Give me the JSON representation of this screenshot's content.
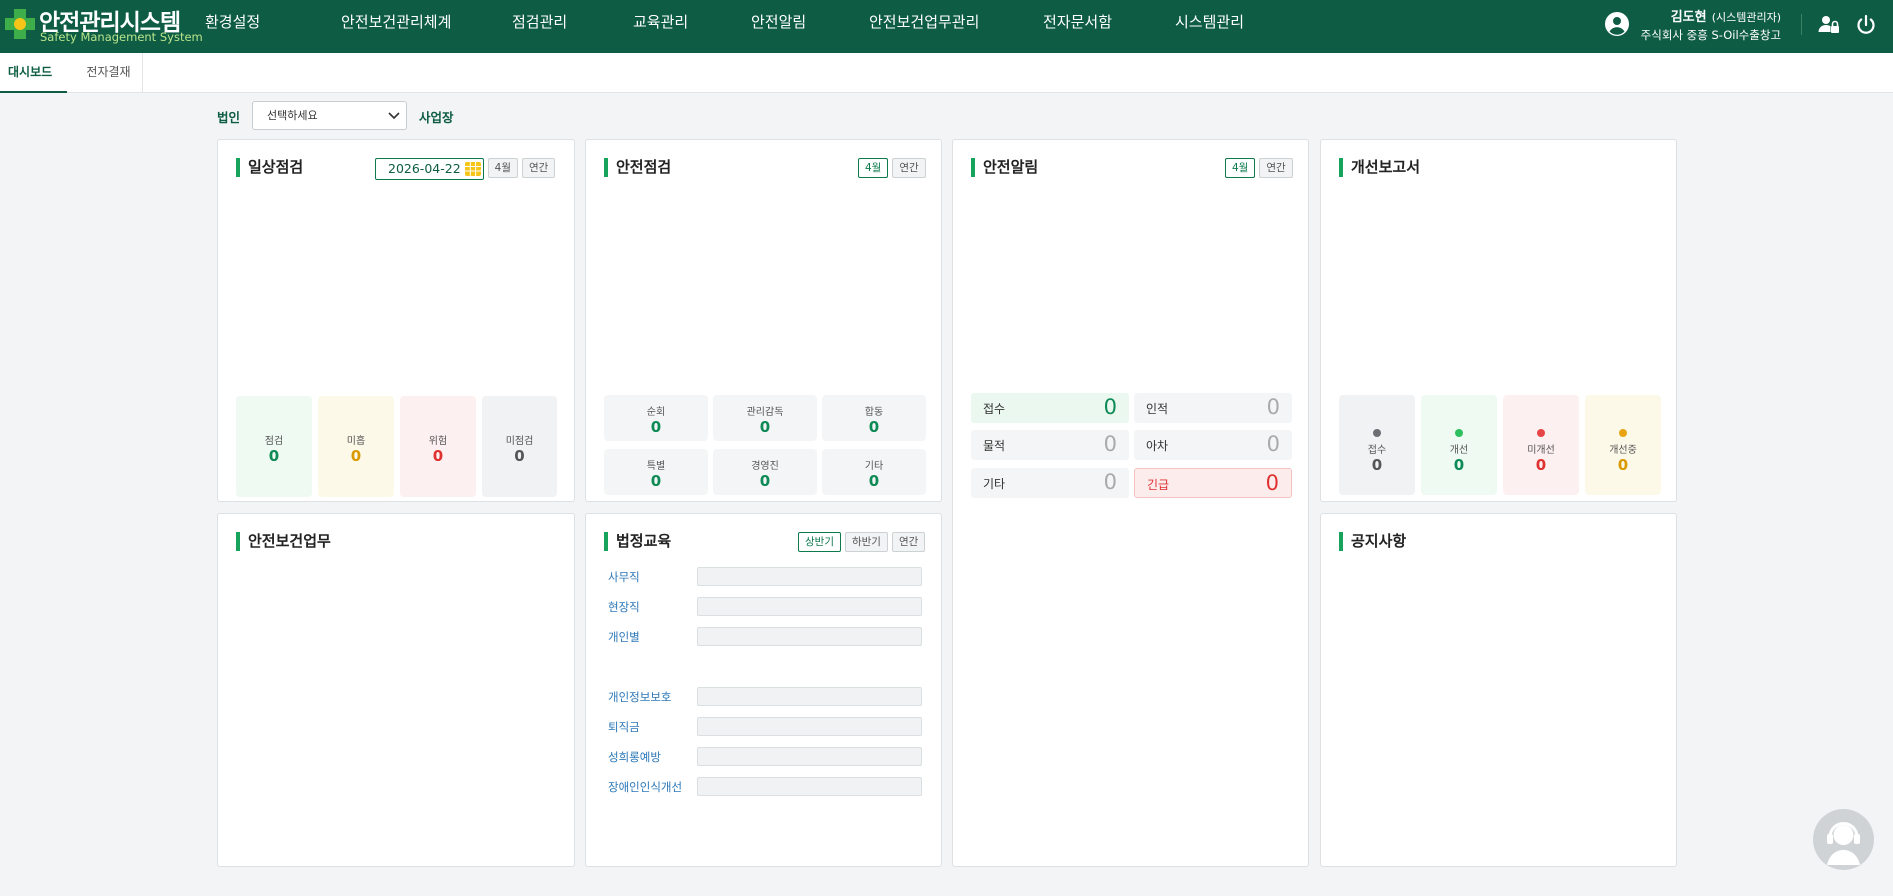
{
  "header": {
    "logo_title": "안전관리시스템",
    "logo_subtitle": "Safety Management System",
    "nav": [
      "환경설정",
      "안전보건관리체계",
      "점검관리",
      "교육관리",
      "안전알림",
      "안전보건업무관리",
      "전자문서함",
      "시스템관리"
    ],
    "user_name": "김도현",
    "user_role": "(시스템관리자)",
    "user_company": "주식회사 중흥 S-Oil수출창고",
    "icons": [
      "user-circle-icon",
      "user-lock-icon",
      "power-icon"
    ]
  },
  "tabs": [
    "대시보드",
    "전자결재"
  ],
  "filters": {
    "corp_label": "법인",
    "corp_placeholder": "선택하세요",
    "site_label": "사업장"
  },
  "daily": {
    "title": "일상점검",
    "date": "2026-04-22",
    "month_label": "4월",
    "year_label": "연간",
    "stats": [
      {
        "label": "점검",
        "value": "0"
      },
      {
        "label": "미흡",
        "value": "0"
      },
      {
        "label": "위험",
        "value": "0"
      },
      {
        "label": "미점검",
        "value": "0"
      }
    ]
  },
  "safety_check": {
    "title": "안전점검",
    "month_label": "4월",
    "year_label": "연간",
    "stats": [
      {
        "label": "순회",
        "value": "0"
      },
      {
        "label": "관리감독",
        "value": "0"
      },
      {
        "label": "합동",
        "value": "0"
      },
      {
        "label": "특별",
        "value": "0"
      },
      {
        "label": "경영진",
        "value": "0"
      },
      {
        "label": "기타",
        "value": "0"
      }
    ]
  },
  "alarm": {
    "title": "안전알림",
    "month_label": "4월",
    "year_label": "연간",
    "items": [
      {
        "label": "접수",
        "value": "0"
      },
      {
        "label": "인적",
        "value": "0"
      },
      {
        "label": "물적",
        "value": "0"
      },
      {
        "label": "아차",
        "value": "0"
      },
      {
        "label": "기타",
        "value": "0"
      },
      {
        "label": "긴급",
        "value": "0"
      }
    ]
  },
  "improve": {
    "title": "개선보고서",
    "stats": [
      {
        "label": "접수",
        "value": "0",
        "color": "#6b6f73"
      },
      {
        "label": "개선",
        "value": "0",
        "color": "#2fbf5f"
      },
      {
        "label": "미개선",
        "value": "0",
        "color": "#e64545"
      },
      {
        "label": "개선중",
        "value": "0",
        "color": "#e8a410"
      }
    ]
  },
  "work": {
    "title": "안전보건업무"
  },
  "edu": {
    "title": "법정교육",
    "tabs": [
      "상반기",
      "하반기",
      "연간"
    ],
    "rows": [
      "사무직",
      "현장직",
      "개인별",
      "개인정보보호",
      "퇴직금",
      "성희롱예방",
      "장애인인식개선"
    ]
  },
  "notice": {
    "title": "공지사항"
  },
  "colors": {
    "brand": "#0d5c43",
    "accent": "#18a35d",
    "green_value": "#0d8a55",
    "yellow_value": "#d99a00",
    "red_value": "#e03131",
    "gray_value": "#555555"
  }
}
